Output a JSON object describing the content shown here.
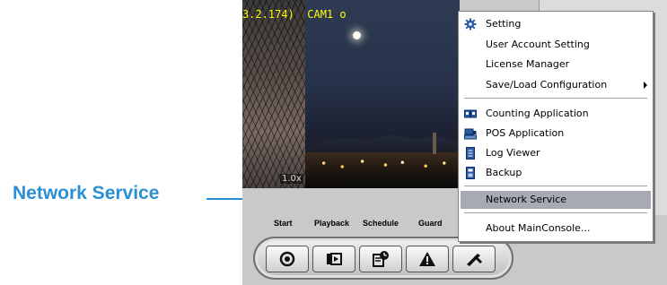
{
  "callout": {
    "label": "Network Service",
    "color": "#2b8fd6"
  },
  "camera": {
    "title": "3.2.174)  CAM1 o",
    "zoom": "1.0x"
  },
  "toolbar": {
    "labels": [
      "Start",
      "Playback",
      "Schedule",
      "Guard"
    ],
    "buttons": [
      {
        "name": "start",
        "icon": "record-icon"
      },
      {
        "name": "playback",
        "icon": "playback-icon"
      },
      {
        "name": "schedule",
        "icon": "schedule-icon"
      },
      {
        "name": "guard",
        "icon": "warning-icon"
      },
      {
        "name": "config",
        "icon": "tools-icon"
      }
    ]
  },
  "context_menu": {
    "items": [
      {
        "label": "Setting",
        "icon": "gear-icon"
      },
      {
        "label": "User Account Setting",
        "icon": ""
      },
      {
        "label": "License Manager",
        "icon": ""
      },
      {
        "label": "Save/Load Configuration",
        "icon": "",
        "submenu": true
      },
      {
        "label": "Counting Application",
        "icon": "counter-icon"
      },
      {
        "label": "POS Application",
        "icon": "pos-icon"
      },
      {
        "label": "Log Viewer",
        "icon": "log-icon"
      },
      {
        "label": "Backup",
        "icon": "backup-icon"
      },
      {
        "label": "Network Service",
        "icon": "",
        "highlighted": true
      },
      {
        "label": "About MainConsole...",
        "icon": ""
      }
    ],
    "highlight_color": "#a7a9b4"
  }
}
